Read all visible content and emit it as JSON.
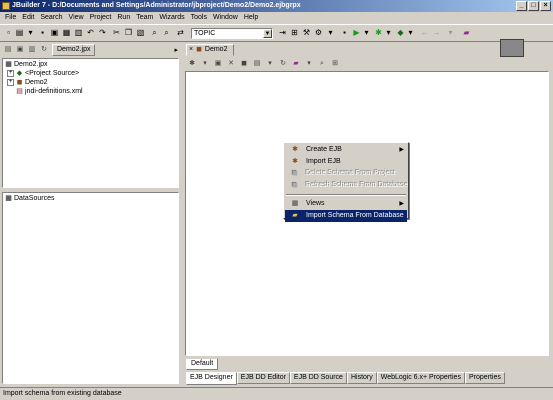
{
  "window": {
    "title": "JBuilder 7 - D:/Documents and Settings/Administrator/jbproject/Demo2/Demo2.ejbgrpx"
  },
  "menubar": [
    "File",
    "Edit",
    "Search",
    "View",
    "Project",
    "Run",
    "Team",
    "Wizards",
    "Tools",
    "Window",
    "Help"
  ],
  "toolbar": {
    "combo_value": "TOPIC"
  },
  "project_panel": {
    "tab_label": "Demo2.jpx"
  },
  "tree": {
    "root": "Demo2.jpx",
    "items": [
      "<Project Source>",
      "Demo2",
      "jndi-definitions.xml"
    ]
  },
  "structure_pane": {
    "item": "DataSources"
  },
  "editor": {
    "tab_label": "Demo2"
  },
  "context_menu": {
    "items": [
      {
        "label": "Create EJB"
      },
      {
        "label": "Import EJB"
      },
      {
        "label": "Import Schema From Database"
      }
    ],
    "disabled": [
      "Delete Schema From Project",
      "Refresh Schema From Database"
    ],
    "views": "Views"
  },
  "default_tab": "Default",
  "bottom_tabs": [
    "EJB Designer",
    "EJB DD Editor",
    "EJB DD Source",
    "History",
    "WebLogic 6.x+ Properties",
    "Properties"
  ],
  "status": "Import schema from existing database"
}
